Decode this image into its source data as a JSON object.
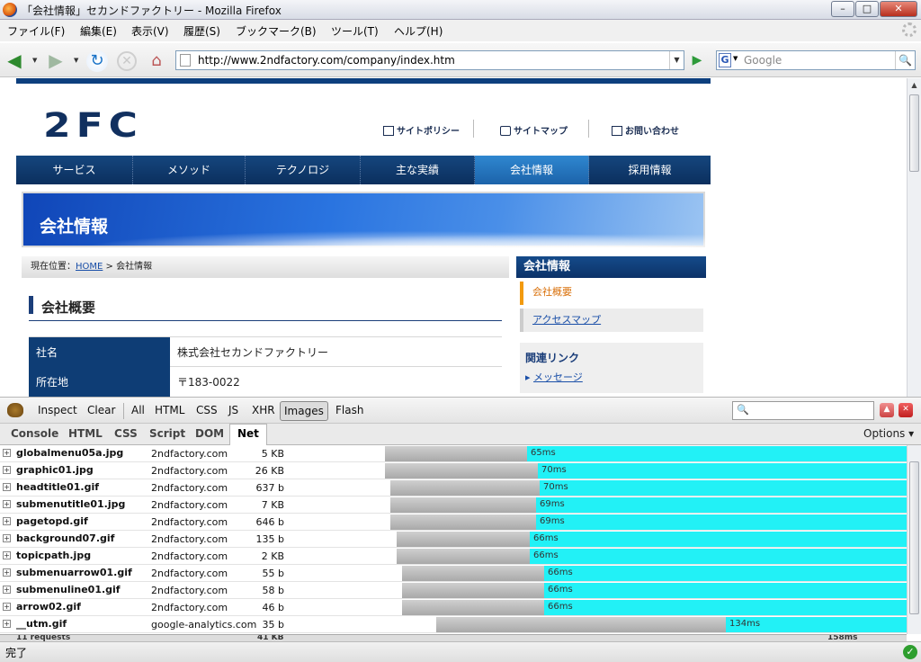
{
  "window": {
    "title": "「会社情報」セカンドファクトリー - Mozilla Firefox"
  },
  "menubar": [
    "ファイル(F)",
    "編集(E)",
    "表示(V)",
    "履歴(S)",
    "ブックマーク(B)",
    "ツール(T)",
    "ヘルプ(H)"
  ],
  "navbar": {
    "url": "http://www.2ndfactory.com/company/index.htm",
    "search_placeholder": "Google"
  },
  "site": {
    "logo": "2FC",
    "utility": [
      "サイトポリシー",
      "サイトマップ",
      "お問い合わせ"
    ],
    "gnav": [
      "サービス",
      "メソッド",
      "テクノロジ",
      "主な実績",
      "会社情報",
      "採用情報"
    ],
    "gnav_active": "会社情報",
    "banner_title": "会社情報",
    "breadcrumb_prefix": "現在位置：",
    "breadcrumb_home": "HOME",
    "breadcrumb_sep": " > ",
    "breadcrumb_current": "会社情報",
    "heading": "会社概要",
    "table": [
      {
        "label": "社名",
        "value": "株式会社セカンドファクトリー"
      },
      {
        "label": "所在地",
        "value": "〒183-0022"
      }
    ],
    "side_title": "会社情報",
    "side_items": [
      "会社概要",
      "アクセスマップ"
    ],
    "related_title": "関連リンク",
    "related_link": "メッセージ"
  },
  "firebug": {
    "toolbar": [
      "Inspect",
      "Clear",
      "All",
      "HTML",
      "CSS",
      "JS",
      "XHR",
      "Images",
      "Flash"
    ],
    "selected_filter": "Images",
    "tabs": [
      "Console",
      "HTML",
      "CSS",
      "Script",
      "DOM",
      "Net"
    ],
    "selected_tab": "Net",
    "options": "Options",
    "requests": [
      {
        "file": "globalmenu05a.jpg",
        "domain": "2ndfactory.com",
        "size": "5 KB",
        "time": "65ms",
        "start": 0.0,
        "wait": 158,
        "recv": 430
      },
      {
        "file": "graphic01.jpg",
        "domain": "2ndfactory.com",
        "size": "26 KB",
        "time": "70ms",
        "start": 0.0,
        "wait": 170,
        "recv": 418
      },
      {
        "file": "headtitle01.gif",
        "domain": "2ndfactory.com",
        "size": "637 b",
        "time": "70ms",
        "start": 6,
        "wait": 166,
        "recv": 416
      },
      {
        "file": "submenutitle01.jpg",
        "domain": "2ndfactory.com",
        "size": "7 KB",
        "time": "69ms",
        "start": 6,
        "wait": 162,
        "recv": 420
      },
      {
        "file": "pagetopd.gif",
        "domain": "2ndfactory.com",
        "size": "646 b",
        "time": "69ms",
        "start": 6,
        "wait": 162,
        "recv": 420
      },
      {
        "file": "background07.gif",
        "domain": "2ndfactory.com",
        "size": "135 b",
        "time": "66ms",
        "start": 13,
        "wait": 148,
        "recv": 427
      },
      {
        "file": "topicpath.jpg",
        "domain": "2ndfactory.com",
        "size": "2 KB",
        "time": "66ms",
        "start": 13,
        "wait": 148,
        "recv": 427
      },
      {
        "file": "submenuarrow01.gif",
        "domain": "2ndfactory.com",
        "size": "55 b",
        "time": "66ms",
        "start": 19,
        "wait": 158,
        "recv": 411
      },
      {
        "file": "submenuline01.gif",
        "domain": "2ndfactory.com",
        "size": "58 b",
        "time": "66ms",
        "start": 19,
        "wait": 158,
        "recv": 411
      },
      {
        "file": "arrow02.gif",
        "domain": "2ndfactory.com",
        "size": "46 b",
        "time": "66ms",
        "start": 19,
        "wait": 158,
        "recv": 411
      },
      {
        "file": "__utm.gif",
        "domain": "google-analytics.com",
        "size": "35 b",
        "time": "134ms",
        "start": 57,
        "wait": 322,
        "recv": 201
      }
    ],
    "summary": {
      "requests": "11 requests",
      "size": "41 KB",
      "time": "158ms"
    }
  },
  "status": "完了"
}
